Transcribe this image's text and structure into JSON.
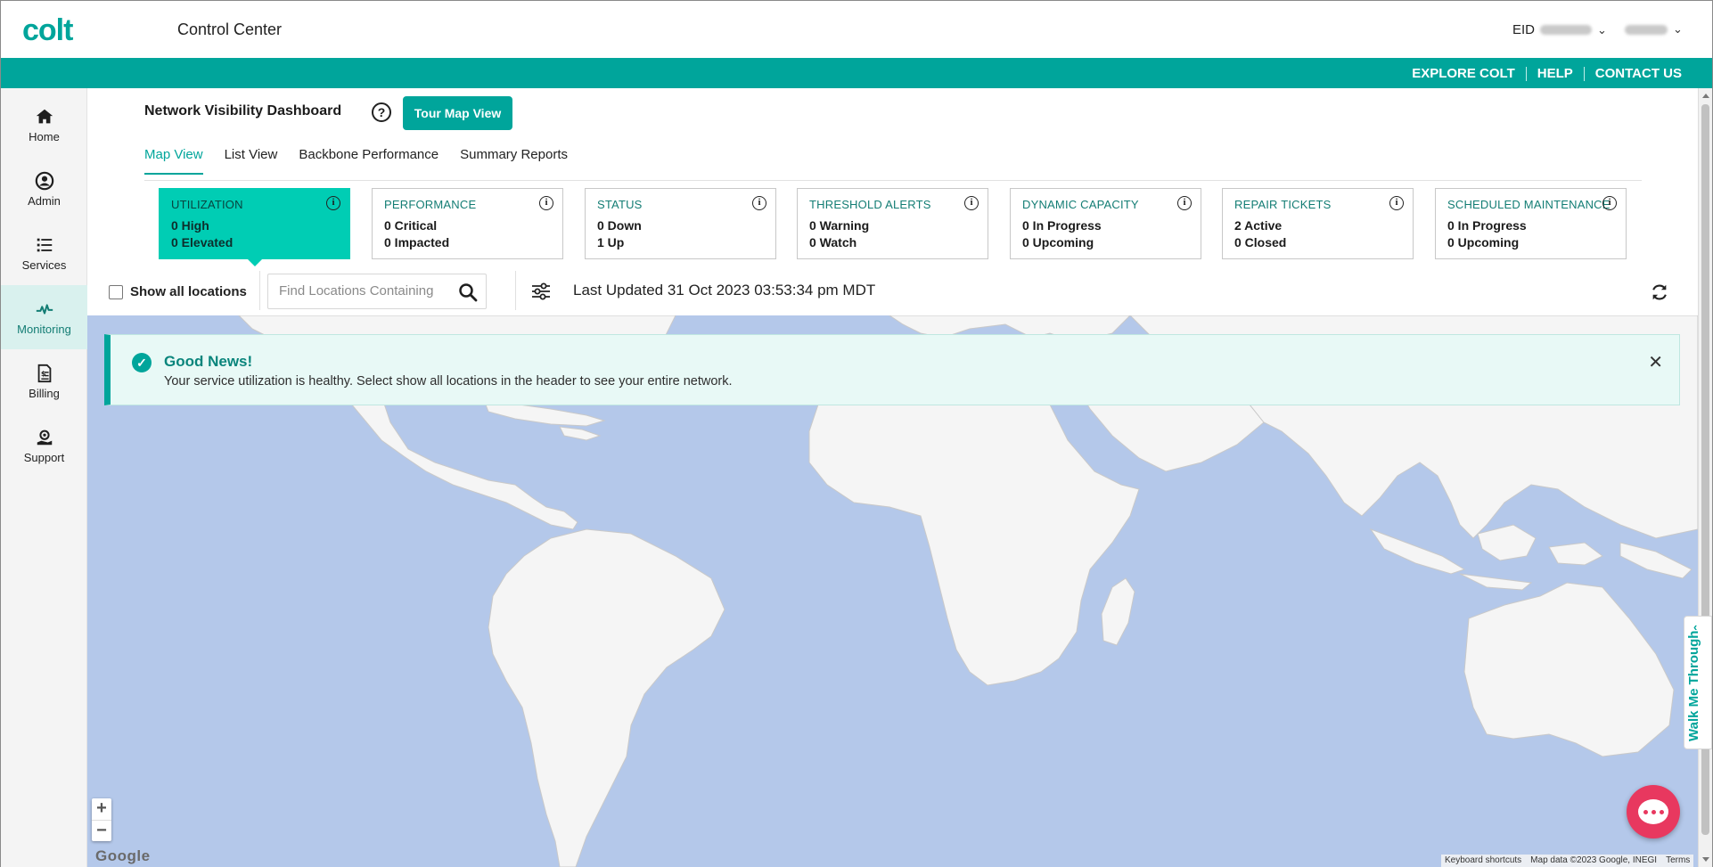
{
  "header": {
    "logo": "colt",
    "app_title": "Control Center",
    "eid_label": "EID"
  },
  "teal_nav": {
    "links": [
      "EXPLORE COLT",
      "HELP",
      "CONTACT US"
    ]
  },
  "sidebar": {
    "items": [
      {
        "label": "Home",
        "icon": "home-icon"
      },
      {
        "label": "Admin",
        "icon": "user-icon"
      },
      {
        "label": "Services",
        "icon": "list-icon"
      },
      {
        "label": "Monitoring",
        "icon": "pulse-icon",
        "active": true
      },
      {
        "label": "Billing",
        "icon": "invoice-icon"
      },
      {
        "label": "Support",
        "icon": "support-icon"
      }
    ]
  },
  "dashboard": {
    "title": "Network Visibility Dashboard",
    "help_symbol": "?",
    "tour_button": "Tour Map View",
    "tabs": [
      {
        "label": "Map View",
        "active": true
      },
      {
        "label": "List View"
      },
      {
        "label": "Backbone Performance"
      },
      {
        "label": "Summary Reports"
      }
    ]
  },
  "cards": [
    {
      "title": "UTILIZATION",
      "line1": "0 High",
      "line2": "0 Elevated",
      "active": true
    },
    {
      "title": "PERFORMANCE",
      "line1": "0 Critical",
      "line2": "0 Impacted"
    },
    {
      "title": "STATUS",
      "line1": "0 Down",
      "line2": "1 Up"
    },
    {
      "title": "THRESHOLD ALERTS",
      "line1": "0 Warning",
      "line2": "0 Watch"
    },
    {
      "title": "DYNAMIC CAPACITY",
      "line1": "0 In Progress",
      "line2": "0 Upcoming"
    },
    {
      "title": "REPAIR TICKETS",
      "line1": "2 Active",
      "line2": "0 Closed"
    },
    {
      "title": "SCHEDULED MAINTENANCE",
      "line1": "0 In Progress",
      "line2": "0 Upcoming"
    }
  ],
  "filters": {
    "show_all_label": "Show all locations",
    "search_placeholder": "Find Locations Containing",
    "last_updated": "Last Updated 31 Oct 2023 03:53:34 pm MDT"
  },
  "alert": {
    "title": "Good News!",
    "message": "Your service utilization is healthy. Select show all locations in the header to see your entire network.",
    "close_symbol": "✕"
  },
  "map": {
    "zoom_in": "+",
    "zoom_out": "−",
    "google_label": "Google",
    "footer": [
      "Keyboard shortcuts",
      "Map data ©2023 Google, INEGI",
      "Terms"
    ]
  },
  "walk_me": "Walk Me Through",
  "colors": {
    "brand": "#00a59b",
    "active_card": "#00cdb4",
    "water": "#b4c8ea",
    "land": "#f5f5f5",
    "chat": "#e8385f"
  }
}
